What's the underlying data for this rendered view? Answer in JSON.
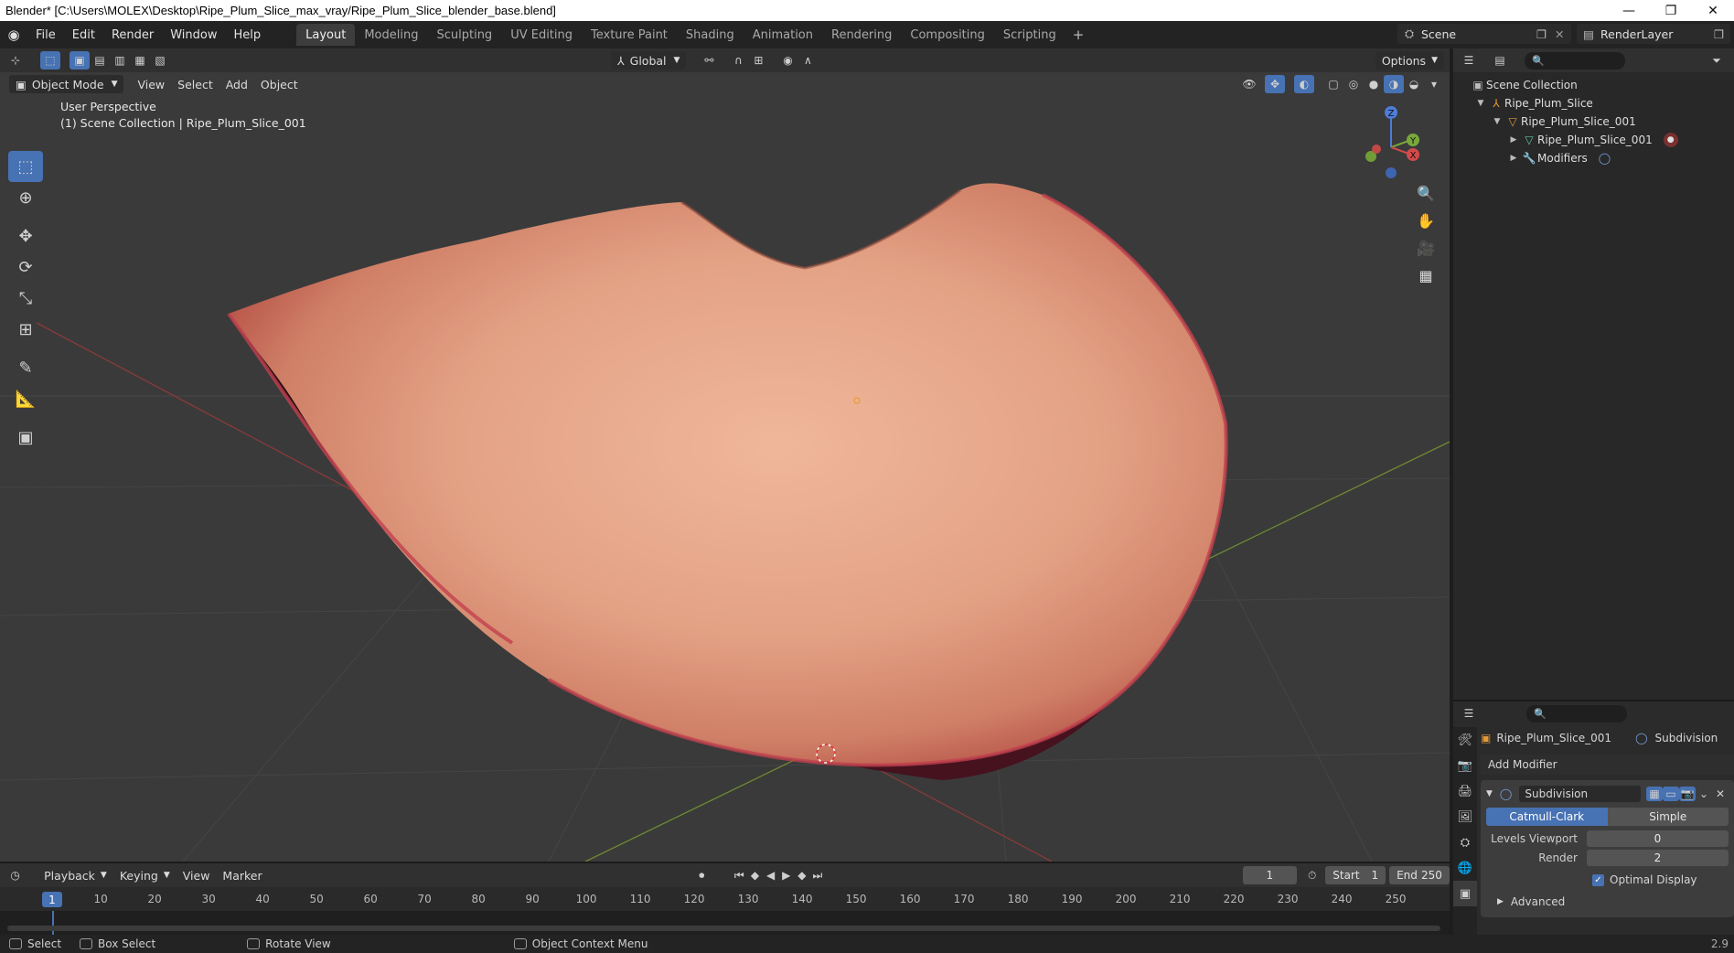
{
  "window": {
    "title": "Blender* [C:\\Users\\MOLEX\\Desktop\\Ripe_Plum_Slice_max_vray/Ripe_Plum_Slice_blender_base.blend]",
    "minimize": "—",
    "maximize": "❐",
    "close": "✕"
  },
  "menu": [
    "File",
    "Edit",
    "Render",
    "Window",
    "Help"
  ],
  "workspaces": [
    "Layout",
    "Modeling",
    "Sculpting",
    "UV Editing",
    "Texture Paint",
    "Shading",
    "Animation",
    "Rendering",
    "Compositing",
    "Scripting"
  ],
  "active_workspace": "Layout",
  "scene": {
    "name": "Scene",
    "render_layer": "RenderLayer"
  },
  "viewport": {
    "mode": "Object Mode",
    "header_menus": [
      "View",
      "Select",
      "Add",
      "Object"
    ],
    "orientation": "Global",
    "options": "Options",
    "perspective_label": "User Perspective",
    "collection_label": "(1) Scene Collection | Ripe_Plum_Slice_001",
    "gizmo": {
      "z": "Z",
      "y": "Y",
      "x": "X"
    }
  },
  "outliner": {
    "root": "Scene Collection",
    "items": [
      {
        "label": "Ripe_Plum_Slice",
        "depth": 0
      },
      {
        "label": "Ripe_Plum_Slice_001",
        "depth": 1
      },
      {
        "label": "Ripe_Plum_Slice_001",
        "depth": 2
      },
      {
        "label": "Modifiers",
        "depth": 2
      }
    ]
  },
  "properties": {
    "object_name": "Ripe_Plum_Slice_001",
    "modifier_name_crumb": "Subdivision",
    "add_modifier": "Add Modifier",
    "modifier": {
      "name": "Subdivision",
      "mode_options": [
        "Catmull-Clark",
        "Simple"
      ],
      "active_mode": "Catmull-Clark",
      "levels_viewport_label": "Levels Viewport",
      "levels_viewport": "0",
      "render_label": "Render",
      "render": "2",
      "optimal_display_label": "Optimal Display",
      "optimal_display": true,
      "advanced_label": "Advanced"
    }
  },
  "timeline": {
    "menus": [
      "Playback",
      "Keying",
      "View",
      "Marker"
    ],
    "current_frame": "1",
    "start_label": "Start",
    "start": "1",
    "end_label": "End",
    "end": "250",
    "ticks": [
      "1",
      "10",
      "20",
      "30",
      "40",
      "50",
      "60",
      "70",
      "80",
      "90",
      "100",
      "110",
      "120",
      "130",
      "140",
      "150",
      "160",
      "170",
      "180",
      "190",
      "200",
      "210",
      "220",
      "230",
      "240",
      "250"
    ]
  },
  "statusbar": {
    "select": "Select",
    "box_select": "Box Select",
    "rotate_view": "Rotate View",
    "context_menu": "Object Context Menu",
    "version": "2.9"
  },
  "colors": {
    "accent": "#4772b3",
    "viewport_bg": "#3a3a3a",
    "flesh": "#e7a98a",
    "skin": "#3a1020"
  }
}
